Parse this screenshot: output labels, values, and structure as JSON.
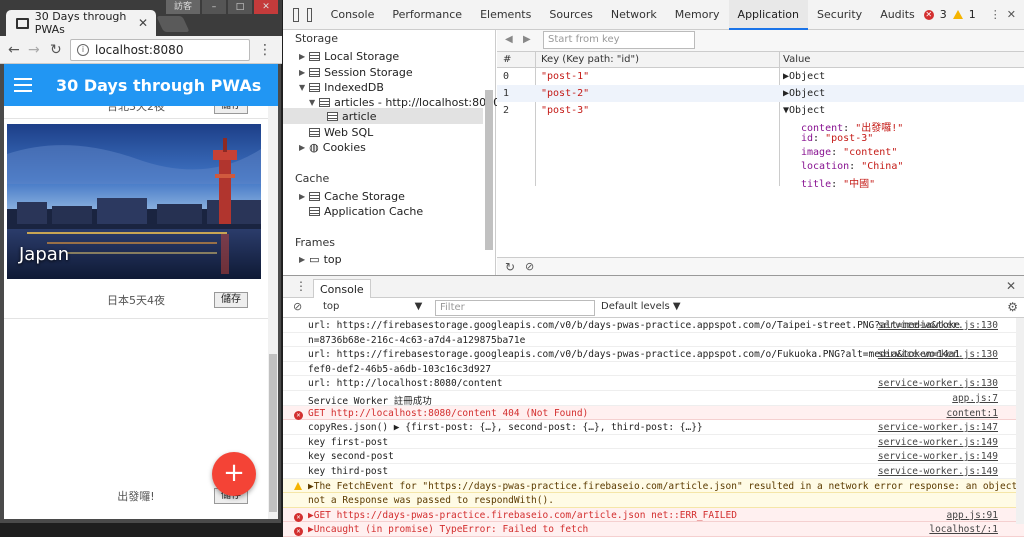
{
  "browser": {
    "tab_title": "30 Days through PWAs",
    "user_badge": "訪客",
    "url": "localhost:8080",
    "app_title": "30 Days through PWAs",
    "top_card_sub": "台北3天2夜",
    "save_label": "儲存",
    "card_title": "Japan",
    "card_sub": "日本5天4夜",
    "bottom_card_sub": "出發囉!",
    "fab_label": "+"
  },
  "devtools": {
    "tabs": [
      "Console",
      "Performance",
      "Elements",
      "Sources",
      "Network",
      "Memory",
      "Application",
      "Security",
      "Audits"
    ],
    "active_tab": "Application",
    "error_count": "3",
    "warning_count": "1",
    "sidebar": {
      "storage_header": "Storage",
      "local_storage": "Local Storage",
      "session_storage": "Session Storage",
      "indexeddb": "IndexedDB",
      "db_name": "articles - http://localhost:8080",
      "store_name": "article",
      "web_sql": "Web SQL",
      "cookies": "Cookies",
      "cache_header": "Cache",
      "cache_storage": "Cache Storage",
      "app_cache": "Application Cache",
      "frames_header": "Frames",
      "frame_top": "top"
    },
    "idb": {
      "filter_placeholder": "Start from key",
      "col_num": "#",
      "col_key": "Key (Key path: \"id\")",
      "col_value": "Value",
      "rows": [
        {
          "n": "0",
          "key": "\"post-1\"",
          "value": "Object"
        },
        {
          "n": "1",
          "key": "\"post-2\"",
          "value": "Object"
        },
        {
          "n": "2",
          "key": "\"post-3\"",
          "value": "Object"
        }
      ],
      "expanded": [
        {
          "k": "content",
          "v": "\"出發囉!\""
        },
        {
          "k": "id",
          "v": "\"post-3\""
        },
        {
          "k": "image",
          "v": "\"content\""
        },
        {
          "k": "location",
          "v": "\"China\""
        },
        {
          "k": "title",
          "v": "\"中國\""
        }
      ]
    },
    "console": {
      "tab_label": "Console",
      "context": "top",
      "filter_placeholder": "Filter",
      "levels": "Default levels ▼",
      "logs": [
        {
          "type": "log",
          "text": "url: https://firebasestorage.googleapis.com/v0/b/days-pwas-practice.appspot.com/o/Taipei-street.PNG?alt=media&toke",
          "src": "service-worker.js:130"
        },
        {
          "type": "log",
          "text": "n=8736b68e-216c-4c63-a7d4-a129875ba71e",
          "src": ""
        },
        {
          "type": "log",
          "text": "url: https://firebasestorage.googleapis.com/v0/b/days-pwas-practice.appspot.com/o/Fukuoka.PNG?alt=media&token=14a1",
          "src": "service-worker.js:130"
        },
        {
          "type": "log",
          "text": "fef0-def2-46b5-a6db-103c16c3d927",
          "src": ""
        },
        {
          "type": "log",
          "text": "url: http://localhost:8080/content",
          "src": "service-worker.js:130"
        },
        {
          "type": "log",
          "text": "Service Worker 註冊成功",
          "src": "app.js:7"
        },
        {
          "type": "err",
          "text": "GET http://localhost:8080/content 404 (Not Found)",
          "src": "content:1"
        },
        {
          "type": "log",
          "text": "copyRes.json() ▶ {first-post: {…}, second-post: {…}, third-post: {…}}",
          "src": "service-worker.js:147"
        },
        {
          "type": "log",
          "text": "key first-post",
          "src": "service-worker.js:149"
        },
        {
          "type": "log",
          "text": "key second-post",
          "src": "service-worker.js:149"
        },
        {
          "type": "log",
          "text": "key third-post",
          "src": "service-worker.js:149"
        },
        {
          "type": "warn",
          "text": "▶The FetchEvent for \"https://days-pwas-practice.firebaseio.com/article.json\" resulted in a network error response: an object that was",
          "src": ""
        },
        {
          "type": "warn",
          "text": "not a Response was passed to respondWith().",
          "src": ""
        },
        {
          "type": "err",
          "text": "▶GET https://days-pwas-practice.firebaseio.com/article.json net::ERR_FAILED",
          "src": "app.js:91"
        },
        {
          "type": "err",
          "text": "▶Uncaught (in promise) TypeError: Failed to fetch",
          "src": "localhost/:1"
        }
      ]
    }
  },
  "colors": {
    "app_bar": "#2196f3",
    "fab": "#f44336",
    "error_bg": "#fff0f0",
    "warn_bg": "#fffbe5",
    "accent": "#1a73e8"
  }
}
